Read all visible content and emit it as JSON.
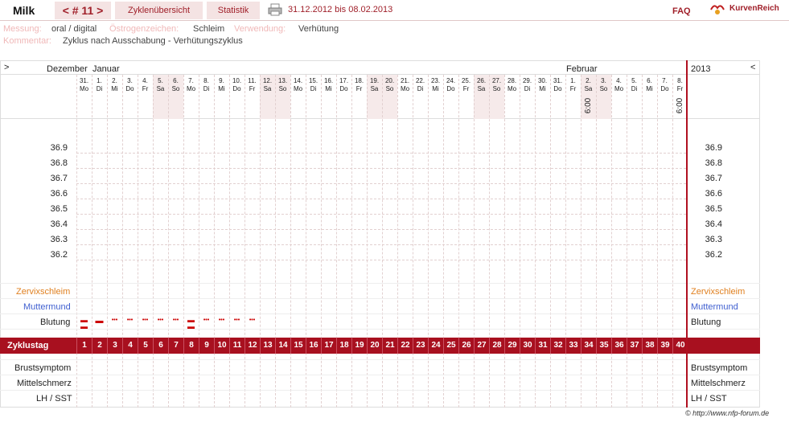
{
  "header": {
    "user": "Milk",
    "cycle_nav": "< # 11 >",
    "tab_overview": "Zyklenübersicht",
    "tab_stats": "Statistik",
    "date_range": "31.12.2012 bis 08.02.2013",
    "faq": "FAQ",
    "brand": "KurvenReich"
  },
  "meta": {
    "messung_label": "Messung:",
    "messung_value": "oral / digital",
    "oestrogen_label": "Östrogenzeichen:",
    "oestrogen_value": "Schleim",
    "verwendung_label": "Verwendung:",
    "verwendung_value": "Verhütung",
    "kommentar_label": "Kommentar:",
    "kommentar_value": "Zyklus nach Ausschabung - Verhütungszyklus"
  },
  "chart": {
    "nav_left": ">",
    "nav_right": "<",
    "month_dec": "Dezember",
    "month_jan": "Januar",
    "month_feb": "Februar",
    "year": "2013",
    "temps": [
      "36.9",
      "36.8",
      "36.7",
      "36.6",
      "36.5",
      "36.4",
      "36.3",
      "36.2"
    ],
    "time_34": "6:00",
    "time_40": "6:00",
    "days": [
      {
        "d": "31.",
        "w": "Mo"
      },
      {
        "d": "1.",
        "w": "Di"
      },
      {
        "d": "2.",
        "w": "Mi"
      },
      {
        "d": "3.",
        "w": "Do"
      },
      {
        "d": "4.",
        "w": "Fr"
      },
      {
        "d": "5.",
        "w": "Sa"
      },
      {
        "d": "6.",
        "w": "So"
      },
      {
        "d": "7.",
        "w": "Mo"
      },
      {
        "d": "8.",
        "w": "Di"
      },
      {
        "d": "9.",
        "w": "Mi"
      },
      {
        "d": "10.",
        "w": "Do"
      },
      {
        "d": "11.",
        "w": "Fr"
      },
      {
        "d": "12.",
        "w": "Sa"
      },
      {
        "d": "13.",
        "w": "So"
      },
      {
        "d": "14.",
        "w": "Mo"
      },
      {
        "d": "15.",
        "w": "Di"
      },
      {
        "d": "16.",
        "w": "Mi"
      },
      {
        "d": "17.",
        "w": "Do"
      },
      {
        "d": "18.",
        "w": "Fr"
      },
      {
        "d": "19.",
        "w": "Sa"
      },
      {
        "d": "20.",
        "w": "So"
      },
      {
        "d": "21.",
        "w": "Mo"
      },
      {
        "d": "22.",
        "w": "Di"
      },
      {
        "d": "23.",
        "w": "Mi"
      },
      {
        "d": "24.",
        "w": "Do"
      },
      {
        "d": "25.",
        "w": "Fr"
      },
      {
        "d": "26.",
        "w": "Sa"
      },
      {
        "d": "27.",
        "w": "So"
      },
      {
        "d": "28.",
        "w": "Mo"
      },
      {
        "d": "29.",
        "w": "Di"
      },
      {
        "d": "30.",
        "w": "Mi"
      },
      {
        "d": "31.",
        "w": "Do"
      },
      {
        "d": "1.",
        "w": "Fr"
      },
      {
        "d": "2.",
        "w": "Sa"
      },
      {
        "d": "3.",
        "w": "So"
      },
      {
        "d": "4.",
        "w": "Mo"
      },
      {
        "d": "5.",
        "w": "Di"
      },
      {
        "d": "6.",
        "w": "Mi"
      },
      {
        "d": "7.",
        "w": "Do"
      },
      {
        "d": "8.",
        "w": "Fr"
      }
    ],
    "weekend_days": [
      6,
      7,
      13,
      14,
      20,
      21,
      27,
      28,
      34,
      35
    ],
    "zyklustag_label": "Zyklustag",
    "zervix_label": "Zervixschleim",
    "muttermund_label": "Muttermund",
    "blutung_label": "Blutung",
    "brust_label": "Brustsymptom",
    "mittel_label": "Mittelschmerz",
    "lh_label": "LH / SST",
    "blutung": [
      "heavy",
      "medium",
      "light",
      "light",
      "light",
      "light",
      "light",
      "heavy",
      "light",
      "light",
      "light",
      "light"
    ]
  },
  "footer": {
    "copyright": "© http://www.nfp-forum.de"
  }
}
